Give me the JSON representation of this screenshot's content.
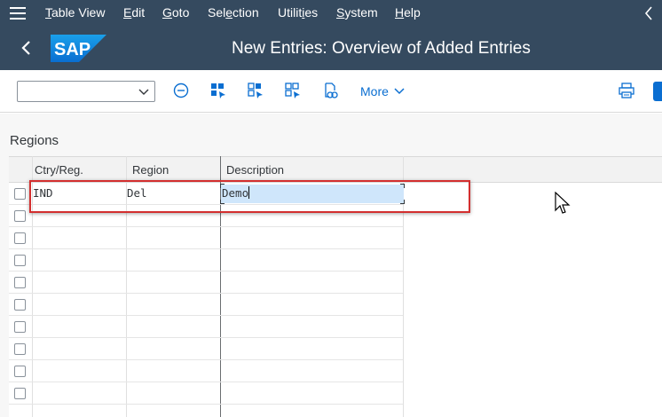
{
  "menubar": {
    "items": [
      {
        "label_ul": "T",
        "label_rest": "able View"
      },
      {
        "label_ul": "E",
        "label_rest": "dit"
      },
      {
        "label_ul": "G",
        "label_rest": "oto"
      },
      {
        "label_pre": "Sel",
        "label_ul": "e",
        "label_rest": "ction"
      },
      {
        "label_pre": "Utilit",
        "label_ul": "i",
        "label_rest": "es"
      },
      {
        "label_ul": "S",
        "label_rest": "ystem"
      },
      {
        "label_ul": "H",
        "label_rest": "elp"
      }
    ]
  },
  "titlebar": {
    "logo_text": "SAP",
    "title": "New Entries: Overview of Added Entries"
  },
  "toolbar": {
    "combo_value": "",
    "more_label": "More"
  },
  "section": {
    "title": "Regions"
  },
  "table": {
    "columns": [
      "Ctry/Reg.",
      "Region",
      "Description"
    ],
    "rows": [
      {
        "ctry": "IND",
        "region": "Del",
        "description": "Demo"
      },
      {
        "ctry": "",
        "region": "",
        "description": ""
      },
      {
        "ctry": "",
        "region": "",
        "description": ""
      },
      {
        "ctry": "",
        "region": "",
        "description": ""
      },
      {
        "ctry": "",
        "region": "",
        "description": ""
      },
      {
        "ctry": "",
        "region": "",
        "description": ""
      },
      {
        "ctry": "",
        "region": "",
        "description": ""
      },
      {
        "ctry": "",
        "region": "",
        "description": ""
      },
      {
        "ctry": "",
        "region": "",
        "description": ""
      },
      {
        "ctry": "",
        "region": "",
        "description": ""
      }
    ]
  },
  "colors": {
    "shell": "#354a5f",
    "accent": "#0a6ed1",
    "highlight_border": "#d32f2f",
    "selection": "#cfe6fb"
  }
}
